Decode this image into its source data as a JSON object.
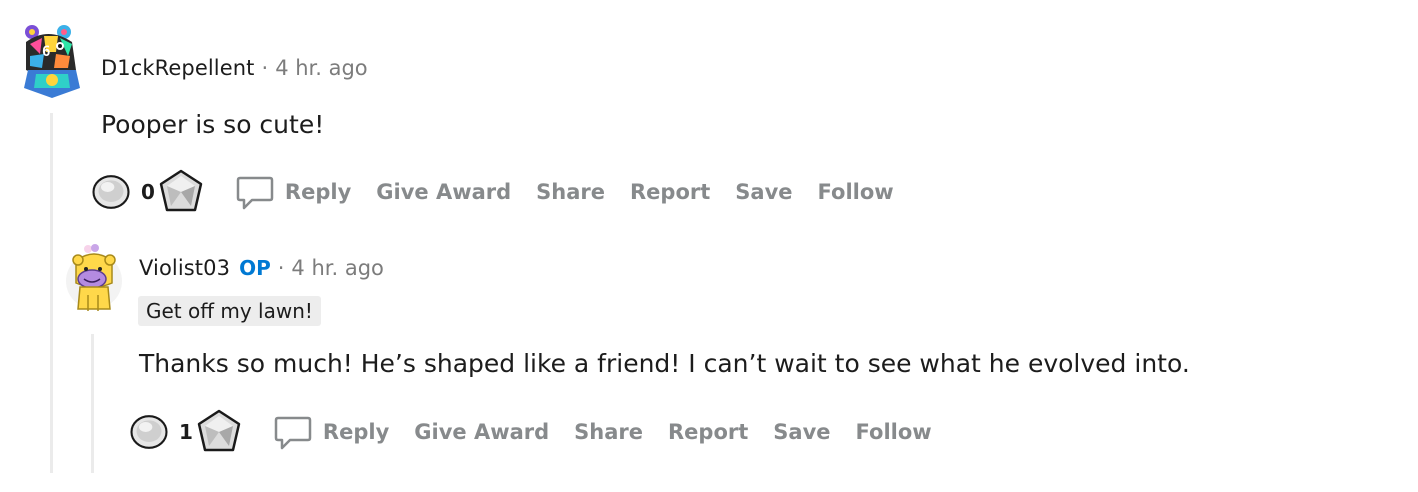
{
  "comments": [
    {
      "username": "D1ckRepellent",
      "separator": "·",
      "time": "4 hr. ago",
      "body": "Pooper is so cute!",
      "score": "0",
      "actions": {
        "reply": "Reply",
        "give_award": "Give Award",
        "share": "Share",
        "report": "Report",
        "save": "Save",
        "follow": "Follow"
      }
    },
    {
      "username": "Violist03",
      "op_badge": "OP",
      "separator": "·",
      "time": "4 hr. ago",
      "flair": "Get off my lawn!",
      "body": "Thanks so much! He’s shaped like a friend! I can’t wait to see what he evolved into.",
      "score": "1",
      "actions": {
        "reply": "Reply",
        "give_award": "Give Award",
        "share": "Share",
        "report": "Report",
        "save": "Save",
        "follow": "Follow"
      }
    }
  ],
  "colors": {
    "op_accent": "#0079d3",
    "muted_text": "#878a8c",
    "thread_line": "#ebebeb"
  },
  "icons": {
    "upvote": "circle-vote-icon",
    "downvote": "diamond-vote-icon",
    "reply": "speech-bubble-icon"
  }
}
